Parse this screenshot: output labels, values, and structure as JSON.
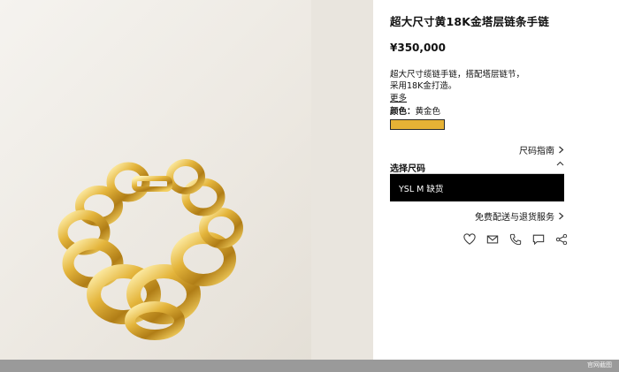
{
  "product": {
    "title": "超大尺寸黄18K金塔层链条手链",
    "price": "¥350,000",
    "description": [
      "超大尺寸缆链手链，搭配塔层链节，",
      "采用18K金打造。"
    ],
    "more_label": "更多",
    "color_label": "颜色：",
    "color_value": "黄金色",
    "swatch_color": "#e6b235"
  },
  "size": {
    "guide_label": "尺码指南",
    "select_label": "选择尺码",
    "option_label": "YSL M 缺货"
  },
  "delivery": {
    "label": "免费配送与退货服务"
  },
  "actions": [
    "heart-icon",
    "mail-icon",
    "phone-icon",
    "chat-icon",
    "share-icon"
  ],
  "footer": {
    "watermark": "官网截图"
  }
}
